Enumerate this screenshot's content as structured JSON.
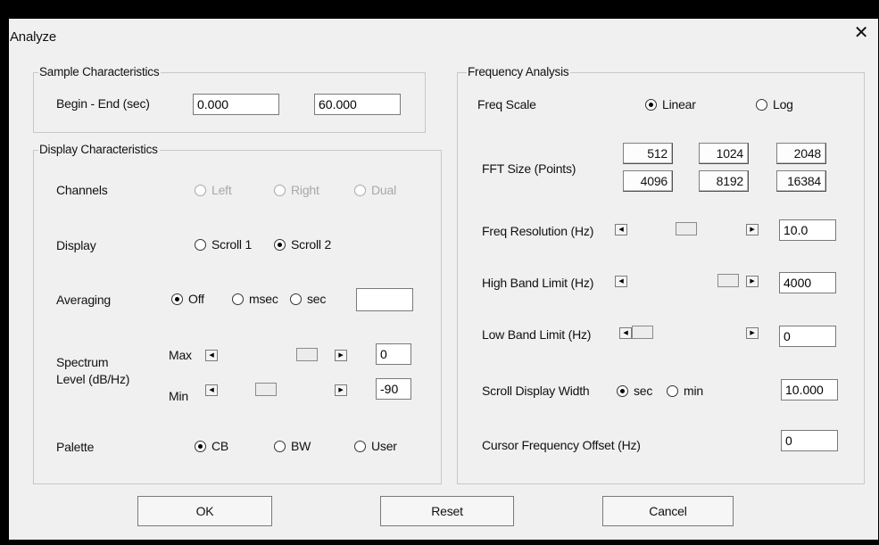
{
  "window": {
    "title": "Analyze",
    "close_glyph": "✕"
  },
  "sample": {
    "legend": "Sample Characteristics",
    "begin_end_label": "Begin - End  (sec)",
    "begin_value": "0.000",
    "end_value": "60.000"
  },
  "display": {
    "legend": "Display Characteristics",
    "channels": {
      "label": "Channels",
      "options": [
        "Left",
        "Right",
        "Dual"
      ],
      "enabled": false
    },
    "display": {
      "label": "Display",
      "options": [
        "Scroll 1",
        "Scroll 2"
      ],
      "selected": "Scroll 2"
    },
    "averaging": {
      "label": "Averaging",
      "options": [
        "Off",
        "msec",
        "sec"
      ],
      "selected": "Off",
      "value": ""
    },
    "spectrum": {
      "label_line1": "Spectrum",
      "label_line2": "Level (dB/Hz)",
      "max_label": "Max",
      "max_value": "0",
      "min_label": "Min",
      "min_value": "-90"
    },
    "palette": {
      "label": "Palette",
      "options": [
        "CB",
        "BW",
        "User"
      ],
      "selected": "CB"
    }
  },
  "frequency": {
    "legend": "Frequency Analysis",
    "freq_scale": {
      "label": "Freq Scale",
      "options": [
        "Linear",
        "Log"
      ],
      "selected": "Linear"
    },
    "fft_size": {
      "label": "FFT Size (Points)",
      "options": [
        "512",
        "1024",
        "2048",
        "4096",
        "8192",
        "16384"
      ]
    },
    "freq_resolution": {
      "label": "Freq Resolution (Hz)",
      "value": "10.0"
    },
    "high_band": {
      "label": "High Band Limit (Hz)",
      "value": "4000"
    },
    "low_band": {
      "label": "Low Band Limit (Hz)",
      "value": "0"
    },
    "scroll_width": {
      "label": "Scroll Display Width",
      "options": [
        "sec",
        "min"
      ],
      "selected": "sec",
      "value": "10.000"
    },
    "cursor_offset": {
      "label": "Cursor Frequency Offset (Hz)",
      "value": "0"
    }
  },
  "buttons": {
    "ok": "OK",
    "reset": "Reset",
    "cancel": "Cancel"
  },
  "icons": {
    "scroll_left": "◀",
    "scroll_right": "▶"
  }
}
